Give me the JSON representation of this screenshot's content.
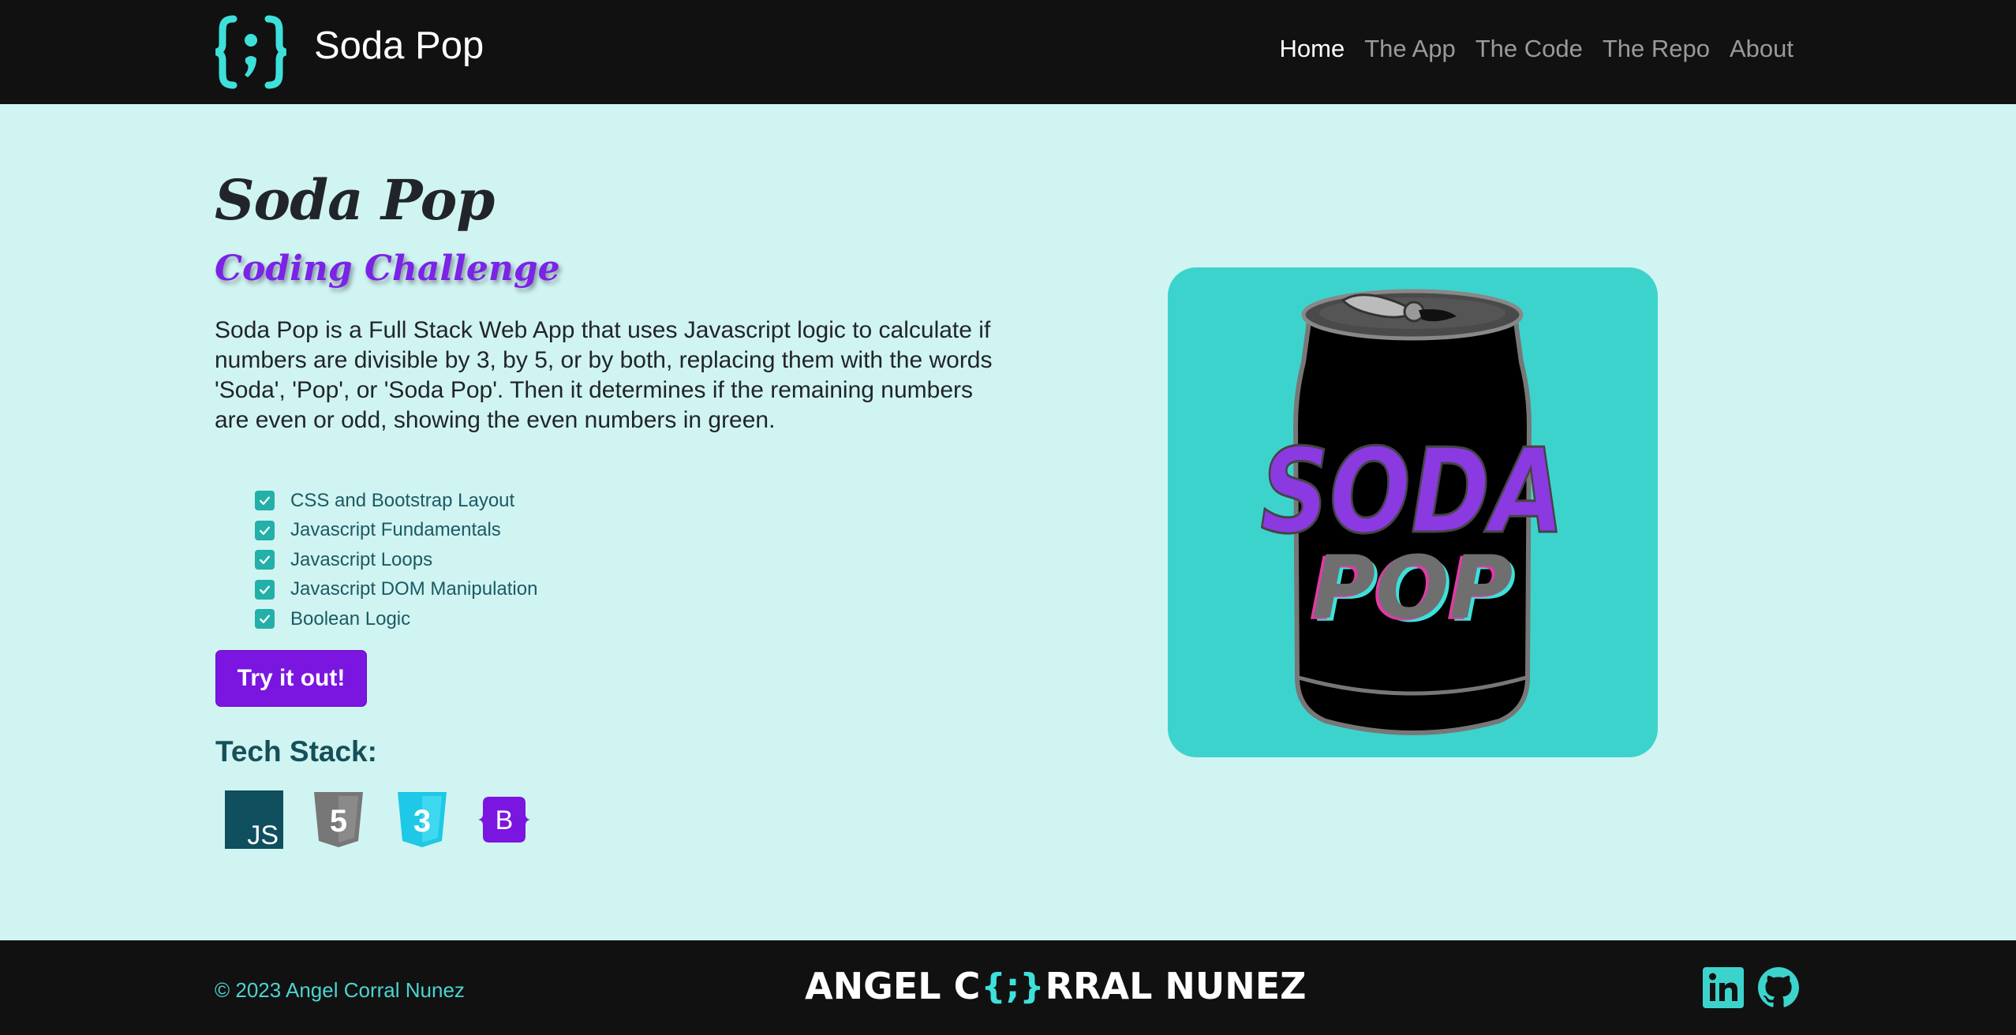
{
  "colors": {
    "accent": "#3dd3cd",
    "purple": "#7b15e0",
    "background": "#d0f4f2",
    "dark": "#111111"
  },
  "navbar": {
    "brand_name": "Soda Pop",
    "links": [
      {
        "label": "Home",
        "active": true
      },
      {
        "label": "The App",
        "active": false
      },
      {
        "label": "The Code",
        "active": false
      },
      {
        "label": "The Repo",
        "active": false
      },
      {
        "label": "About",
        "active": false
      }
    ]
  },
  "hero": {
    "title": "Soda Pop",
    "subtitle": "Coding Challenge",
    "description": "Soda Pop is a Full Stack Web App that uses Javascript logic to calculate if numbers are divisible by 3, by 5, or by both, replacing them with the words 'Soda', 'Pop', or 'Soda Pop'. Then it determines if the remaining numbers are even or odd, showing the even numbers in green.",
    "features": [
      "CSS and Bootstrap Layout",
      "Javascript Fundamentals",
      "Javascript Loops",
      "Javascript DOM Manipulation",
      "Boolean Logic"
    ],
    "cta_label": "Try it out!",
    "tech_heading": "Tech Stack:",
    "tech_icons": [
      {
        "icon": "javascript-icon",
        "label": "JS"
      },
      {
        "icon": "html5-icon",
        "label": "5"
      },
      {
        "icon": "css3-icon",
        "label": "3"
      },
      {
        "icon": "bootstrap-icon",
        "label": "B"
      }
    ],
    "can_text_top": "SODA",
    "can_text_bottom": "POP"
  },
  "footer": {
    "copyright": "© 2023 Angel Corral Nunez",
    "brand_left": "ANGEL C",
    "brand_braces": "{;}",
    "brand_right": "RRAL NUNEZ",
    "social": [
      "linkedin-icon",
      "github-icon"
    ]
  }
}
